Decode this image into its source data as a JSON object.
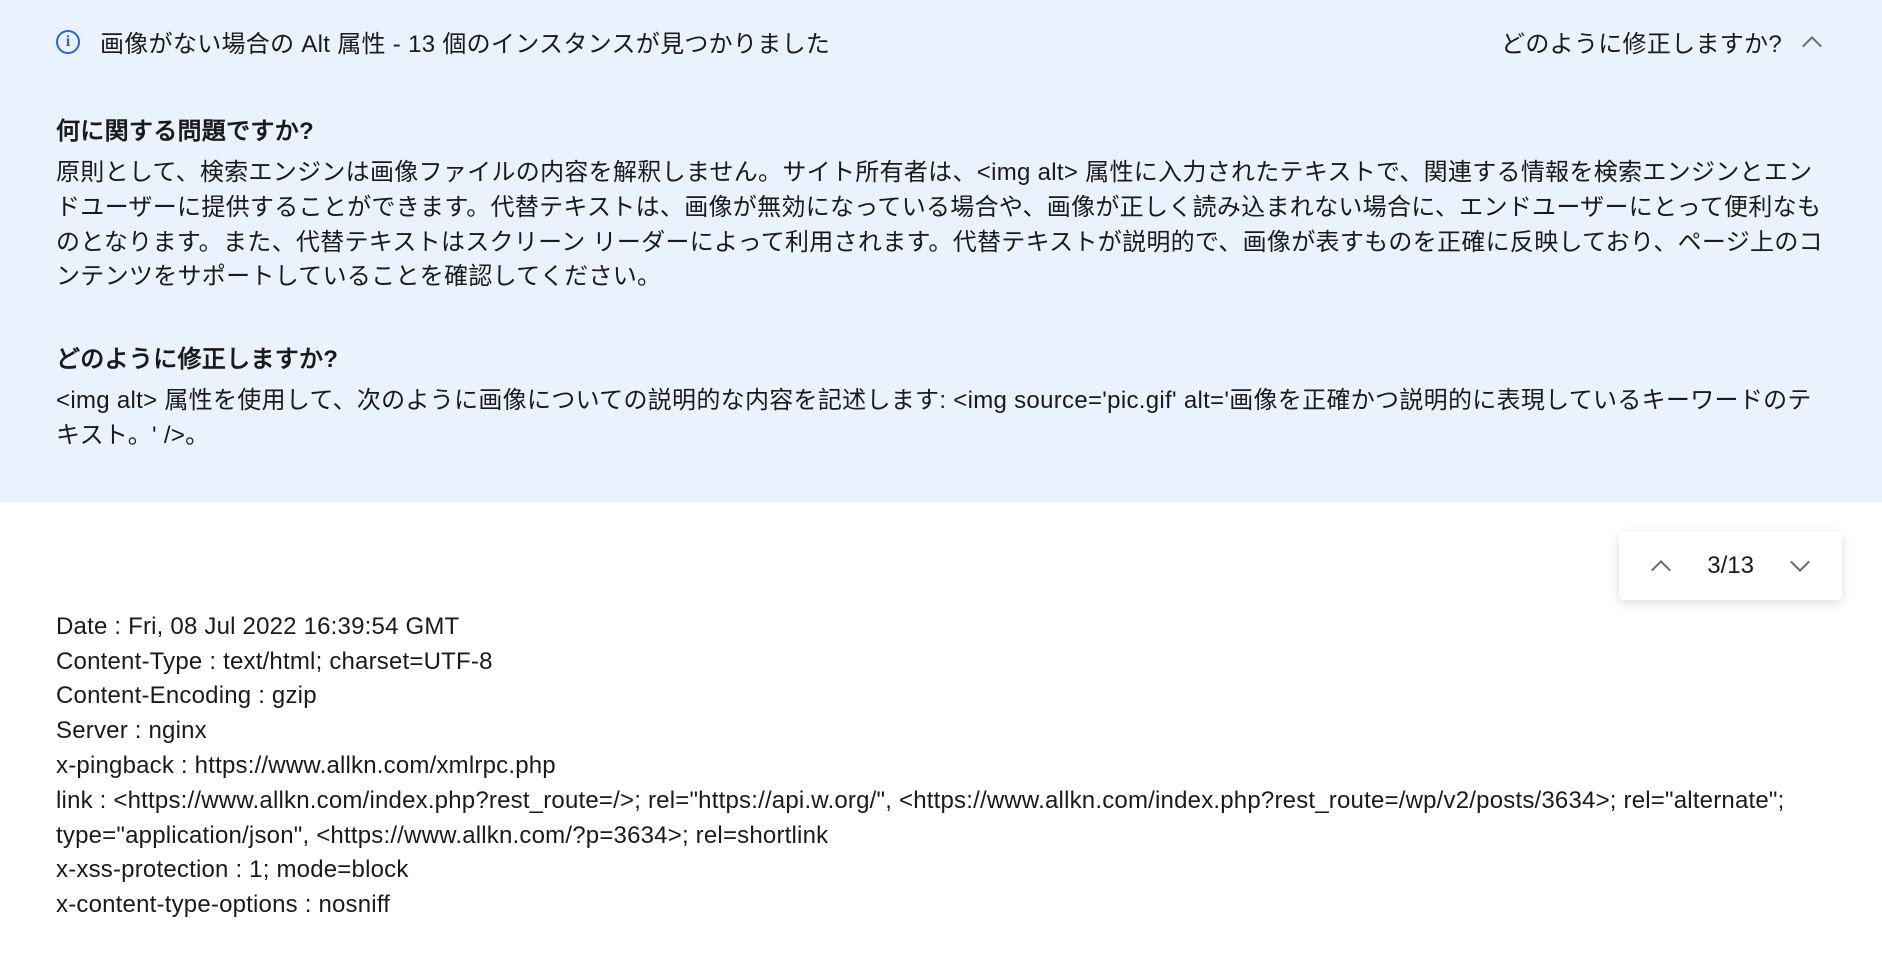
{
  "panel": {
    "title": "画像がない場合の Alt 属性  - 13 個のインスタンスが見つかりました",
    "fix_link": "どのように修正しますか?"
  },
  "sections": {
    "problem_heading": "何に関する問題ですか?",
    "problem_text": "原則として、検索エンジンは画像ファイルの内容を解釈しません。サイト所有者は、<img alt> 属性に入力されたテキストで、関連する情報を検索エンジンとエンドユーザーに提供することができます。代替テキストは、画像が無効になっている場合や、画像が正しく読み込まれない場合に、エンドユーザーにとって便利なものとなります。また、代替テキストはスクリーン リーダーによって利用されます。代替テキストが説明的で、画像が表すものを正確に反映しており、ページ上のコンテンツをサポートしていることを確認してください。",
    "fix_heading": "どのように修正しますか?",
    "fix_text": "<img alt> 属性を使用して、次のように画像についての説明的な内容を記述します: <img source='pic.gif' alt='画像を正確かつ説明的に表現しているキーワードのテキスト。' />。"
  },
  "pager": {
    "count": "3/13"
  },
  "http_headers": {
    "date": "Date : Fri, 08 Jul 2022 16:39:54 GMT",
    "content_type": "Content-Type : text/html; charset=UTF-8",
    "content_encoding": "Content-Encoding : gzip",
    "server": "Server : nginx",
    "x_pingback": "x-pingback : https://www.allkn.com/xmlrpc.php",
    "link": "link : <https://www.allkn.com/index.php?rest_route=/>; rel=\"https://api.w.org/\", <https://www.allkn.com/index.php?rest_route=/wp/v2/posts/3634>; rel=\"alternate\"; type=\"application/json\", <https://www.allkn.com/?p=3634>; rel=shortlink",
    "x_xss_protection": "x-xss-protection : 1; mode=block",
    "x_content_type_options": "x-content-type-options : nosniff"
  }
}
